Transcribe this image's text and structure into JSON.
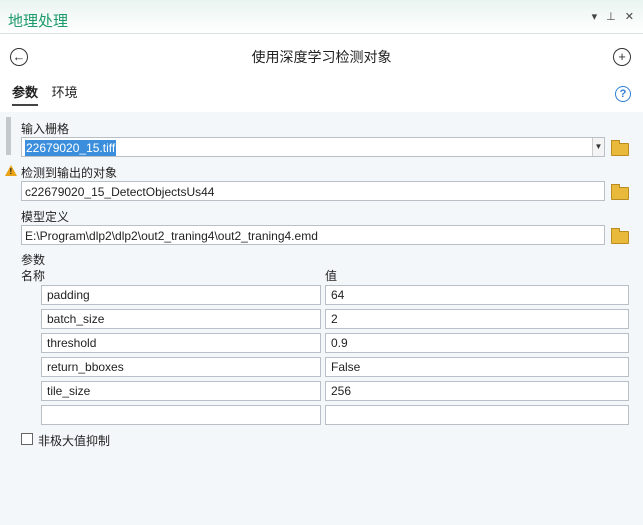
{
  "pane": {
    "title": "地理处理",
    "controls": "▾ ⊥ ✕"
  },
  "tool": {
    "title": "使用深度学习检测对象"
  },
  "tabs": [
    {
      "label": "参数"
    },
    {
      "label": "环境"
    }
  ],
  "help_symbol": "?",
  "input_raster": {
    "label": "输入栅格",
    "value": "22679020_15.tiff"
  },
  "output_objects": {
    "label": "检测到输出的对象",
    "value": "c22679020_15_DetectObjectsUs44"
  },
  "model_definition": {
    "label": "模型定义",
    "value": "E:\\Program\\dlp2\\dlp2\\out2_traning4\\out2_traning4.emd"
  },
  "arguments": {
    "label": "参数",
    "col_name": "名称",
    "col_value": "值",
    "rows": [
      {
        "name": "padding",
        "value": "64"
      },
      {
        "name": "batch_size",
        "value": "2"
      },
      {
        "name": "threshold",
        "value": "0.9"
      },
      {
        "name": "return_bboxes",
        "value": "False"
      },
      {
        "name": "tile_size",
        "value": "256"
      },
      {
        "name": "",
        "value": ""
      }
    ]
  },
  "nms": {
    "label": "非极大值抑制",
    "checked": false
  }
}
